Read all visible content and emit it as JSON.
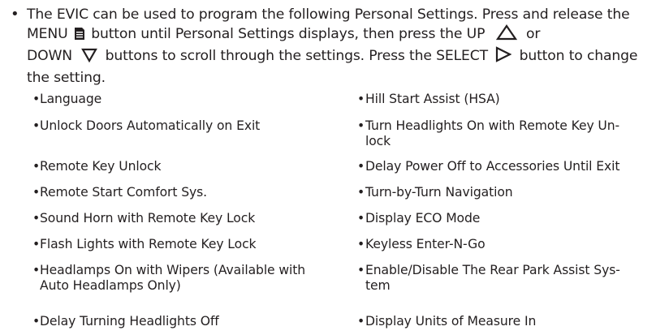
{
  "intro": {
    "bullet": "•",
    "line1": "The EVIC can be used to program the following Personal Settings. Press and release the",
    "line2_a": "MENU",
    "line2_b": "button until Personal Settings displays, then press the UP",
    "line2_c": "or",
    "line3_a": "DOWN",
    "line3_b": "buttons to scroll through the settings. Press the SELECT",
    "line3_c": "button to change",
    "line4": "the setting.",
    "icons": {
      "menu": "menu-document-icon",
      "up": "up-triangle-icon",
      "down": "down-triangle-icon",
      "select": "right-triangle-icon"
    }
  },
  "settings": {
    "left": [
      {
        "l1": "Language"
      },
      {
        "l1": "Unlock Doors Automatically on Exit"
      },
      {
        "l1": "Remote Key Unlock"
      },
      {
        "l1": "Remote Start Comfort Sys."
      },
      {
        "l1": "Sound Horn with Remote Key Lock"
      },
      {
        "l1": "Flash Lights with Remote Key Lock"
      },
      {
        "l1": "Headlamps On with Wipers (Available with",
        "l2": "Auto Headlamps Only)"
      },
      {
        "l1": "Delay Turning Headlights Off"
      }
    ],
    "right": [
      {
        "l1": "Hill Start Assist (HSA)"
      },
      {
        "l1": "Turn Headlights On with Remote Key Un-",
        "l2": "lock"
      },
      {
        "l1": "Delay Power Off to Accessories Until Exit"
      },
      {
        "l1": "Turn-by-Turn Navigation"
      },
      {
        "l1": "Display ECO Mode"
      },
      {
        "l1": "Keyless Enter-N-Go"
      },
      {
        "l1": "Enable/Disable The Rear Park Assist Sys-",
        "l2": "tem"
      },
      {
        "l1": "Display Units of Measure In"
      }
    ],
    "bullet": "•"
  }
}
